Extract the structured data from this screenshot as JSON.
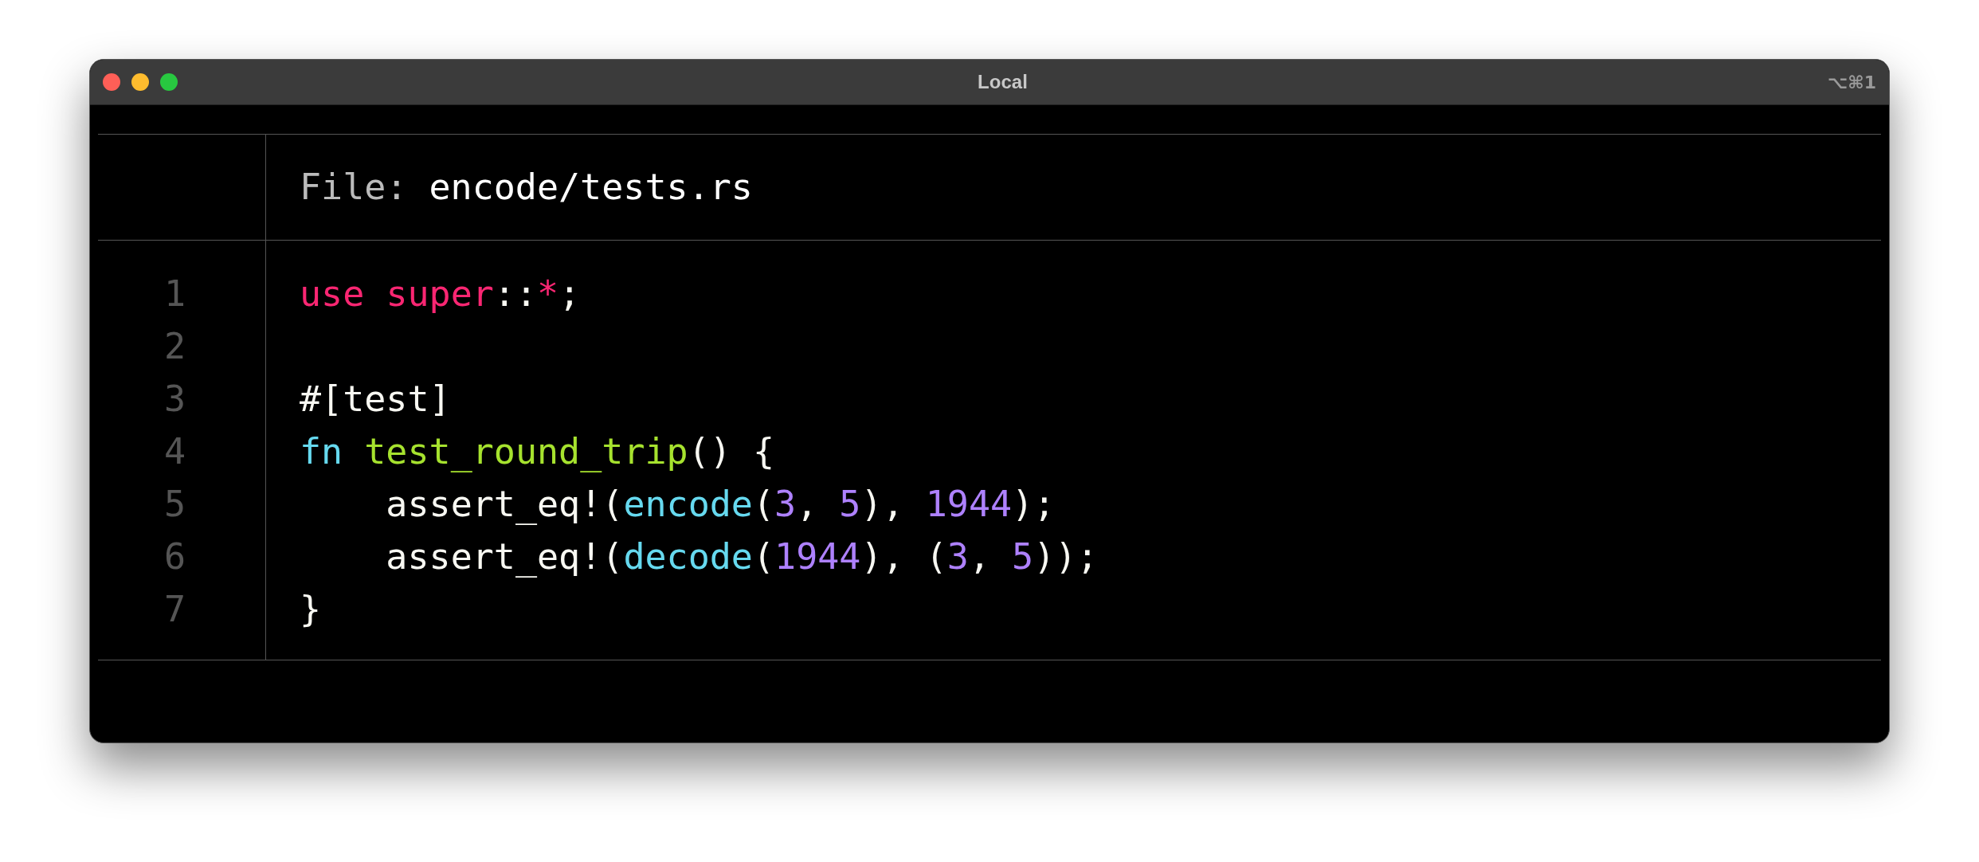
{
  "window": {
    "title": "Local",
    "shortcut": "⌥⌘1"
  },
  "header": {
    "label": "File:",
    "filename": "encode/tests.rs"
  },
  "lines": [
    {
      "number": "1",
      "tokens": [
        {
          "kind": "keyword",
          "text": "use "
        },
        {
          "kind": "keyword",
          "text": "super"
        },
        {
          "kind": "plain",
          "text": "::"
        },
        {
          "kind": "keyword",
          "text": "*"
        },
        {
          "kind": "plain",
          "text": ";"
        }
      ]
    },
    {
      "number": "2"
    },
    {
      "number": "3",
      "tokens": [
        {
          "kind": "plain",
          "text": "#[test]"
        }
      ]
    },
    {
      "number": "4",
      "tokens": [
        {
          "kind": "storage",
          "text": "fn "
        },
        {
          "kind": "entity",
          "text": "test_round_trip"
        },
        {
          "kind": "plain",
          "text": "() {"
        }
      ]
    },
    {
      "number": "5",
      "tokens": [
        {
          "kind": "plain",
          "text": "    assert_eq!("
        },
        {
          "kind": "call",
          "text": "encode"
        },
        {
          "kind": "plain",
          "text": "("
        },
        {
          "kind": "number",
          "text": "3"
        },
        {
          "kind": "plain",
          "text": ", "
        },
        {
          "kind": "number",
          "text": "5"
        },
        {
          "kind": "plain",
          "text": "), "
        },
        {
          "kind": "number",
          "text": "1944"
        },
        {
          "kind": "plain",
          "text": ");"
        }
      ]
    },
    {
      "number": "6",
      "tokens": [
        {
          "kind": "plain",
          "text": "    assert_eq!("
        },
        {
          "kind": "call",
          "text": "decode"
        },
        {
          "kind": "plain",
          "text": "("
        },
        {
          "kind": "number",
          "text": "1944"
        },
        {
          "kind": "plain",
          "text": "), ("
        },
        {
          "kind": "number",
          "text": "3"
        },
        {
          "kind": "plain",
          "text": ", "
        },
        {
          "kind": "number",
          "text": "5"
        },
        {
          "kind": "plain",
          "text": "));"
        }
      ]
    },
    {
      "number": "7",
      "tokens": [
        {
          "kind": "plain",
          "text": "}"
        }
      ]
    }
  ]
}
